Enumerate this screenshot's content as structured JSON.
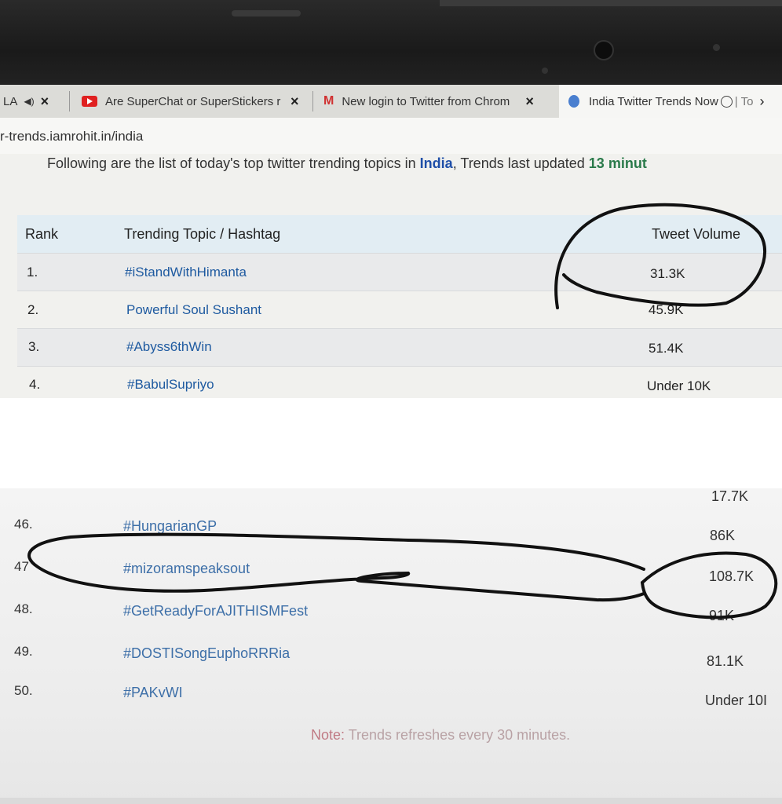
{
  "browser": {
    "tabs": [
      {
        "label": "LA",
        "close": "×"
      },
      {
        "label": "Are SuperChat or SuperStickers r",
        "close": "×"
      },
      {
        "label": "New login to Twitter from Chrom",
        "close": "×"
      },
      {
        "label": "India Twitter Trends Now",
        "suffix": "| To",
        "close": "›"
      }
    ],
    "address": "r-trends.iamrohit.in/india"
  },
  "intro": {
    "text_prefix": "Following are the list of today's top twitter trending topics in ",
    "country": "India",
    "text_mid": ", Trends last updated ",
    "updated": "13 minut"
  },
  "table": {
    "headers": {
      "rank": "Rank",
      "topic": "Trending Topic / Hashtag",
      "volume": "Tweet Volume"
    },
    "rows_top": [
      {
        "rank": "1.",
        "topic": "#iStandWithHimanta",
        "volume": "31.3K"
      },
      {
        "rank": "2.",
        "topic": "Powerful Soul Sushant",
        "volume": "45.9K"
      },
      {
        "rank": "3.",
        "topic": "#Abyss6thWin",
        "volume": "51.4K"
      },
      {
        "rank": "4.",
        "topic": "#BabulSupriyo",
        "volume": "Under 10K"
      }
    ],
    "rows_bottom": [
      {
        "rank": "",
        "topic": "",
        "volume": "17.7K"
      },
      {
        "rank": "46.",
        "topic": "#HungarianGP",
        "volume": "86K"
      },
      {
        "rank": "47",
        "topic": "#mizoramspeaksout",
        "volume": "108.7K"
      },
      {
        "rank": "48.",
        "topic": "#GetReadyForAJITHISMFest",
        "volume": "91K"
      },
      {
        "rank": "49.",
        "topic": "#DOSTISongEuphoRRRia",
        "volume": "81.1K"
      },
      {
        "rank": "50.",
        "topic": "#PAKvWI",
        "volume": "Under 10I"
      }
    ]
  },
  "note": {
    "label": "Note:",
    "text": " Trends refreshes every 30 minutes."
  },
  "colors": {
    "link": "#1e5aa0",
    "header_bg": "#e2edf3",
    "ink": "#111111",
    "youtube": "#e02020"
  },
  "icons": [
    "youtube-icon",
    "gmail-icon",
    "globe-icon",
    "clock-icon"
  ]
}
